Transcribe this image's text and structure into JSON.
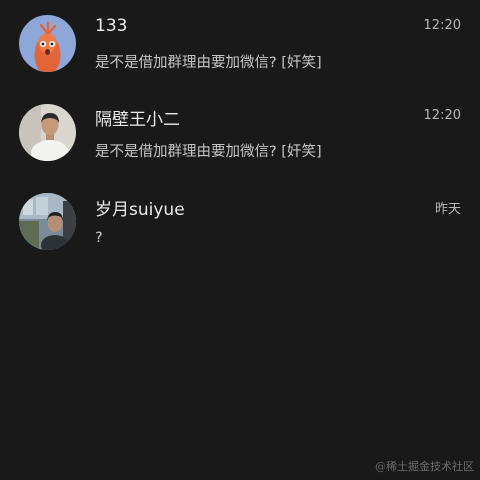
{
  "chats": [
    {
      "name": "133",
      "time": "12:20",
      "preview": "是不是借加群理由要加微信? [奸笑]",
      "avatar_icon": "mascot-avatar-icon",
      "avatar_color": "#8fa6d8"
    },
    {
      "name": "隔壁王小二",
      "time": "12:20",
      "preview": "是不是借加群理由要加微信? [奸笑]",
      "avatar_icon": "person-photo-avatar-icon",
      "avatar_color": "#d9d6cf"
    },
    {
      "name": "岁月suiyue",
      "time": "昨天",
      "preview": "?",
      "avatar_icon": "person-photo-avatar-icon",
      "avatar_color": "#7a8a9a"
    }
  ],
  "watermark": "@稀土掘金技术社区",
  "colors": {
    "background": "#191919",
    "name_text": "#ececec",
    "preview_text": "#c4c4c4",
    "time_text": "#b6b6b6"
  }
}
